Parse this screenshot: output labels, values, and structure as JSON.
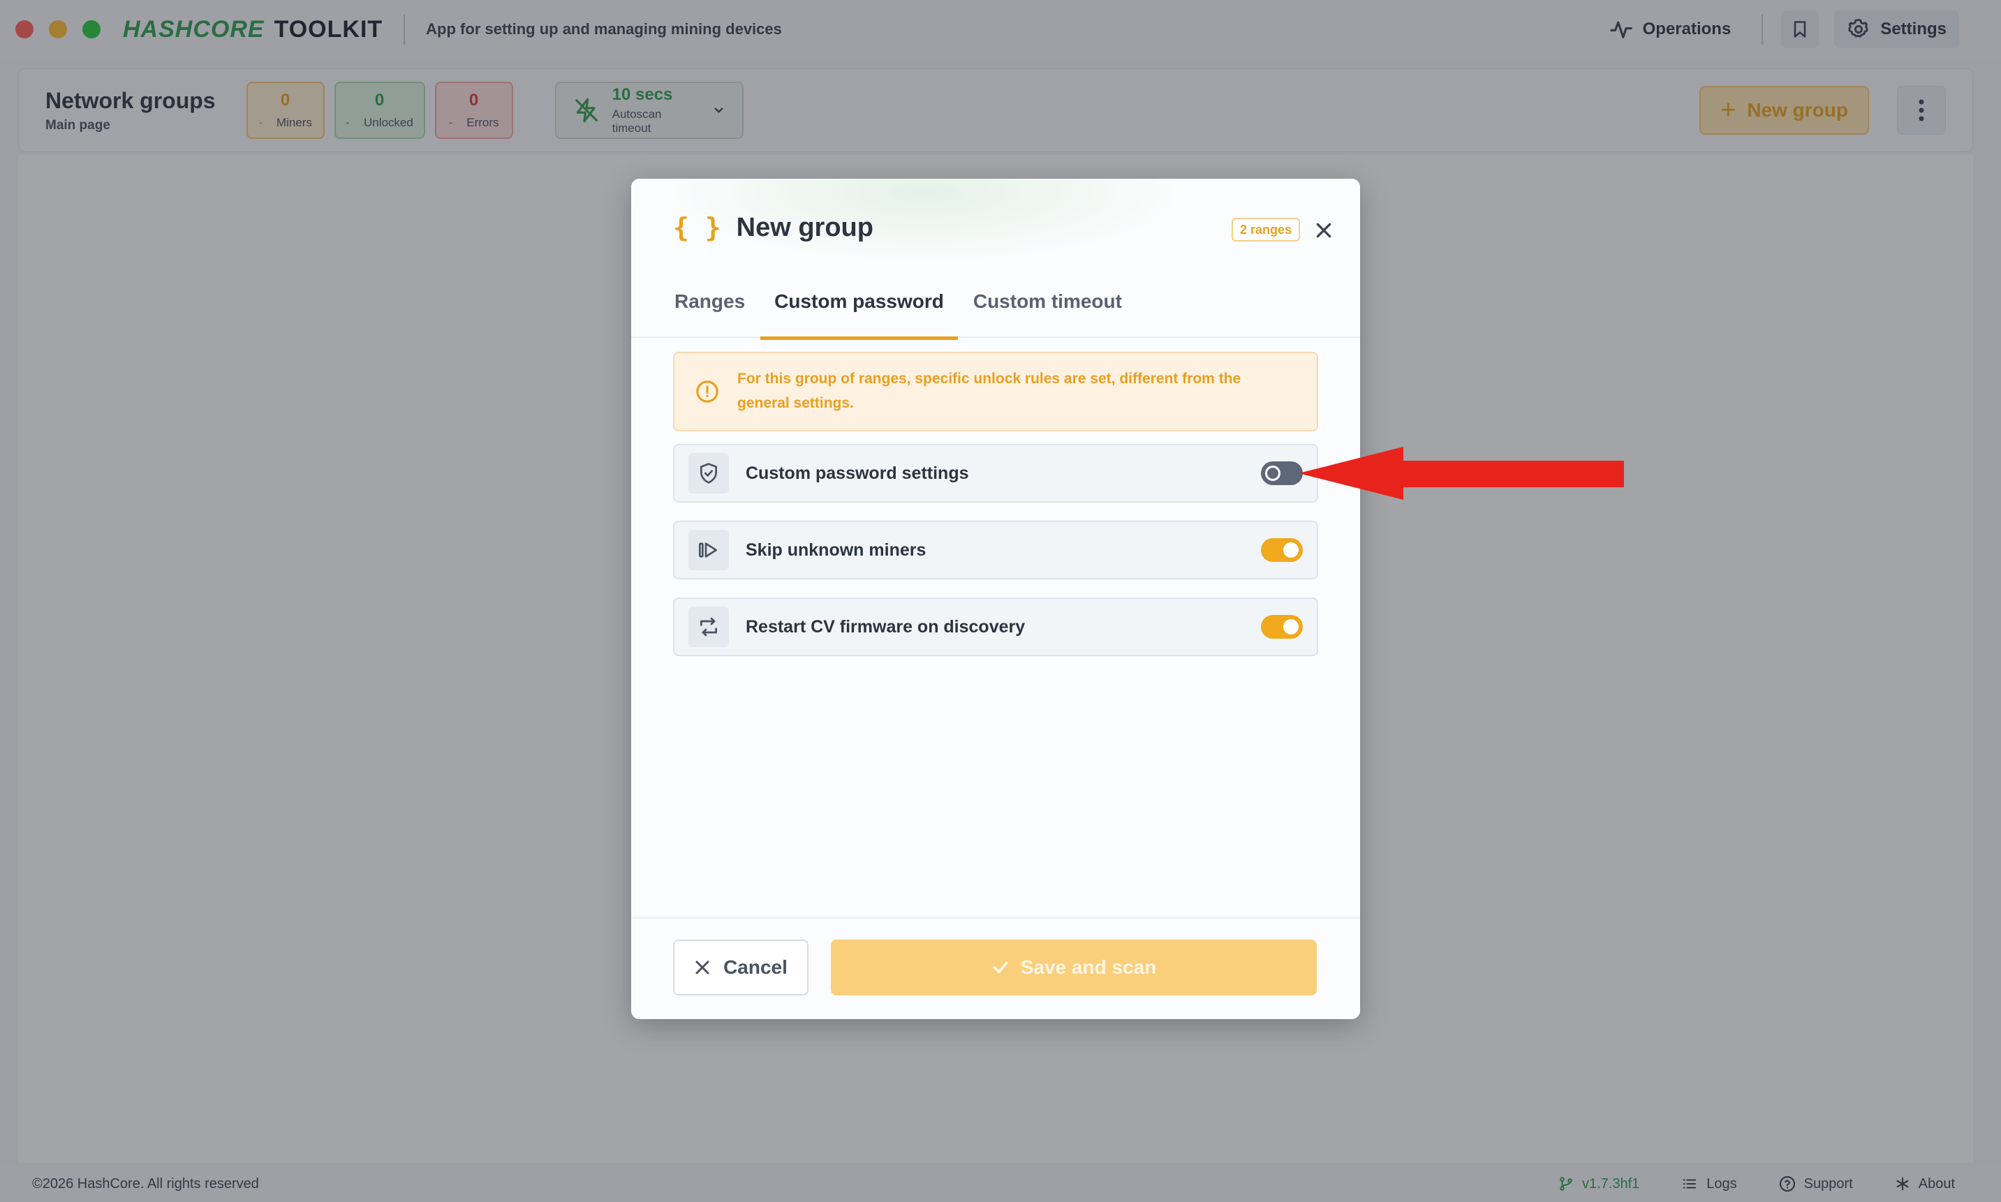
{
  "window": {
    "logo_part1": "HASHCORE",
    "logo_part2": "TOOLKIT",
    "subtitle": "App for setting up and managing mining devices",
    "operations_label": "Operations",
    "settings_label": "Settings"
  },
  "header": {
    "title": "Network groups",
    "subtitle": "Main page",
    "stats": {
      "miners": {
        "value": "0",
        "delta": "-",
        "label": "Miners"
      },
      "unlocked": {
        "value": "0",
        "delta": "-",
        "label": "Unlocked"
      },
      "errors": {
        "value": "0",
        "delta": "-",
        "label": "Errors"
      }
    },
    "autoscan": {
      "value": "10 secs",
      "label": "Autoscan timeout"
    },
    "new_group_label": "New group"
  },
  "footer": {
    "copyright": "©2026 HashCore. All rights reserved",
    "version": "v1.7.3hf1",
    "logs": "Logs",
    "support": "Support",
    "about": "About"
  },
  "modal": {
    "title": "New group",
    "braces": "{ }",
    "badge": "2 ranges",
    "tabs": [
      {
        "label": "Ranges",
        "active": false
      },
      {
        "label": "Custom password",
        "active": true
      },
      {
        "label": "Custom timeout",
        "active": false
      }
    ],
    "alert": "For this group of ranges, specific unlock rules are set, different from the general settings.",
    "options": [
      {
        "label": "Custom password settings",
        "icon": "shield-check-icon",
        "enabled": false
      },
      {
        "label": "Skip unknown miners",
        "icon": "skip-forward-icon",
        "enabled": true
      },
      {
        "label": "Restart CV firmware on discovery",
        "icon": "repeat-icon",
        "enabled": true
      }
    ],
    "cancel_label": "Cancel",
    "save_label": "Save and scan"
  },
  "colors": {
    "accent": "#e8a020",
    "brand_green": "#2e9e4b",
    "error_red": "#d63b3b",
    "annotation_arrow": "#e8231b"
  }
}
